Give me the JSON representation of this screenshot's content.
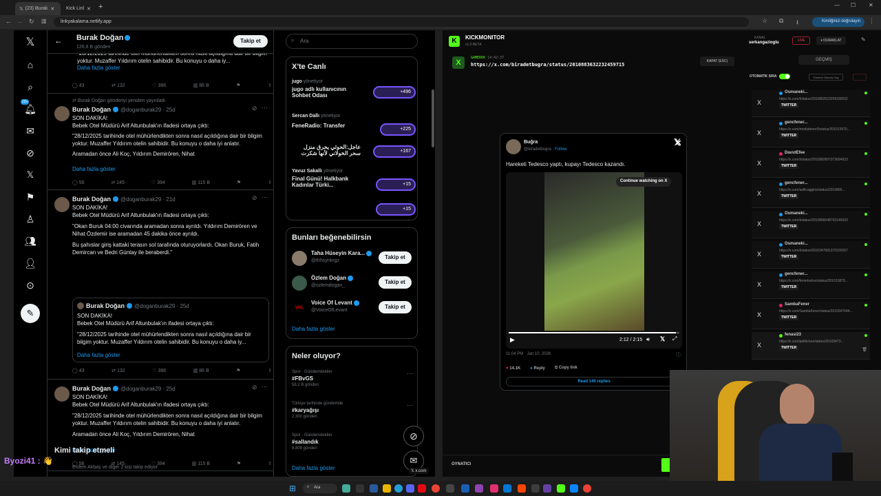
{
  "browser": {
    "tabs": [
      {
        "label": "(23) Burak"
      },
      {
        "label": "Kick Linl"
      }
    ],
    "url": "linkyakalama.netlify.app",
    "verify_label": "Kimliğinizi doğrulayın"
  },
  "profile": {
    "name": "Burak Doğan",
    "count": "126,8 B gönderi",
    "follow_label": "Takip et"
  },
  "search": {
    "placeholder": "Ara"
  },
  "nav_badge": "20+",
  "tweets": [
    {
      "text": "\"28/12/2025 tarihinde otel mühürlendikten sonra nasıl açıldığına dair bir bilgim yoktur. Muzaffer Yıldırım otelin sahibidir. Bu konuyu o daha iy...",
      "more": "Daha fazla göster",
      "replies": "43",
      "retweets": "132",
      "likes": "386",
      "views": "86 B"
    },
    {
      "repost": "Burak Doğan gönderiyi yeniden yayınladı",
      "name": "Burak Doğan",
      "handle": "@doganburak29 · 25d",
      "lines": [
        "SON DAKİKA!",
        "Bebek Otel Müdürü Arif Altunbulak'ın ifadesi ortaya çıktı:",
        "\"28/12/2025 tarihinde otel mühürlendikten sonra nasıl açıldığına dair bir bilgim yoktur. Muzaffer Yıldırım otelin sahibidir. Bu konuyu o daha iyi anlatır.",
        "Aramadan önce Ali Koç, Yıldırım Demirören, Nihat"
      ],
      "more": "Daha fazla göster",
      "replies": "56",
      "retweets": "145",
      "likes": "394",
      "views": "115 B"
    },
    {
      "name": "Burak Doğan",
      "handle": "@doganburak29 · 21d",
      "lines": [
        "SON DAKİKA!",
        "Bebek Otel Müdürü Arif Altunbulak'ın ifadesi ortaya çıktı:",
        "\"Okan Buruk 04:00 civarında aramadan sonra ayrıldı. Yıldırım Demirören ve Nihat Özdemir ise aramadan 45 dakika önce ayrıldı.",
        "Bu şahıslar giriş kattaki terasın sol tarafında oturuyorlardı. Okan Buruk, Fatih Demircan ve Bedri Güntay ile beraberdi.\""
      ],
      "quote": {
        "name": "Burak Doğan",
        "handle": "@doganburak29 · 25d",
        "lines": [
          "SON DAKİKA!",
          "Bebek Otel Müdürü Arif Altunbulak'ın ifadesi ortaya çıktı:",
          "\"28/12/2025 tarihinde otel mühürlendikten sonra nasıl açıldığına dair bir bilgim yoktur. Muzaffer Yıldırım otelin sahibidir. Bu konuyu o daha iy..."
        ],
        "more": "Daha fazla göster"
      },
      "replies": "43",
      "retweets": "132",
      "likes": "386",
      "views": "86 B"
    },
    {
      "name": "Burak Doğan",
      "handle": "@doganburak29 · 25d",
      "lines": [
        "SON DAKİKA!",
        "Bebek Otel Müdürü Arif Altunbulak'ın ifadesi ortaya çıktı:",
        "\"28/12/2025 tarihinde otel mühürlendikten sonra nasıl açıldığına dair bir bilgim yoktur. Muzaffer Yıldırım otelin sahibidir. Bu konuyu o daha iyi anlatır.",
        "Aramadan önce Ali Koç, Yıldırım Demirören, Nihat"
      ],
      "more": "Daha fazla göster",
      "replies": "56",
      "retweets": "145",
      "likes": "394",
      "views": "115 B"
    }
  ],
  "who_follow": {
    "title": "Kimi takip etmeli",
    "sub": "Erdem Akbaş ve diğer 2 kişi takip ediyor"
  },
  "chat": {
    "user": "Byozi41 :",
    "emoji": "👋"
  },
  "live": {
    "title": "X'te Canlı",
    "items": [
      {
        "host": "jugo",
        "role": "yönetiyor",
        "title": "jugo adlı kullanıcının Sohbet Odası",
        "count": "+496"
      },
      {
        "host": "Sercan Dallı",
        "role": "yönetiyor",
        "title": "FeneRadio: Transfer",
        "count": "+225"
      },
      {
        "host": "",
        "role": "",
        "title": "عاجل:الحوثي يحرق منزل سحر الخولاني لأنها شكرت",
        "count": "+167"
      },
      {
        "host": "Yavuz Sakallı",
        "role": "yönetiyor",
        "title": "Final Günü! Halkbank Kadınlar Türki...",
        "count": "+15"
      },
      {
        "host": "",
        "role": "",
        "title": "",
        "count": "+15"
      }
    ]
  },
  "suggest": {
    "title": "Bunları beğenebilirsin",
    "users": [
      {
        "name": "Taha Hüseyin Kara...",
        "handle": "@thhsynkrgz",
        "btn": "Takip et"
      },
      {
        "name": "Özlem Doğan",
        "handle": "@ozlemdogan_",
        "btn": "Takip et"
      },
      {
        "name": "Voice Of Levant",
        "handle": "@VoiceOfLevant",
        "btn": "Takip et"
      }
    ],
    "more": "Daha fazla göster"
  },
  "trends": {
    "title": "Neler oluyor?",
    "items": [
      {
        "cat": "Spor · Gündemdekiler",
        "tag": "#FBvGS",
        "count": "58,2 B gönderi"
      },
      {
        "cat": "Türkiye tarihinde gündemde",
        "tag": "#karyağışı",
        "count": "2.300 gönderi"
      },
      {
        "cat": "Spor · Gündemdekiler",
        "tag": "#sallandık",
        "count": "6.809 gönderi"
      }
    ],
    "more": "Daha fazla göster"
  },
  "kick": {
    "brand": "KICKMONITOR",
    "version": "v1.0 BETA",
    "user_label": "KANAL",
    "username": "serkangazioglu",
    "live": "LIVE",
    "stop": "DURAKLAT",
    "history": "GEÇMİŞ",
    "auto_label": "OTOMATİK SIRA",
    "mark_read": "Tümünü Okundu Say",
    "active_source": "GAMER06",
    "active_time": "14:42:37",
    "active_url": "https://x.com/biradetbugra/status/2010883632232459715",
    "close_label": "KAPAT (ESC)",
    "bottom_label": "OYNATICI",
    "queue": [
      {
        "name": "Osmaneki...",
        "url": "https://x.com/i/status/2010852623299330032",
        "tag": "TWITTER"
      },
      {
        "name": "gencfener...",
        "url": "https://x.com/mediafener0/status/201013970...",
        "tag": "TWITTER"
      },
      {
        "name": "DavutEfee",
        "url": "https://x.com/i/status/2010882897373694923",
        "tag": "TWITTER"
      },
      {
        "name": "gencfener...",
        "url": "https://x.com/aslilcaggine/status/2010866...",
        "tag": "TWITTER"
      },
      {
        "name": "Osmaneki...",
        "url": "https://x.com/i/status/2010856048793145633",
        "tag": "TWITTER"
      },
      {
        "name": "Osmaneki...",
        "url": "https://x.com/i/status/2010347681370229267",
        "tag": "TWITTER"
      },
      {
        "name": "gencfener...",
        "url": "https://x.com/fenerbahce/status/201013870...",
        "tag": "TWITTER"
      },
      {
        "name": "SambaFener",
        "url": "https://x.com/SambaFener/status/2010347644...",
        "tag": "TWITTER"
      },
      {
        "name": "fenasi23",
        "url": "https://x.com/politicture/status/20103473...",
        "tag": "TWITTER"
      }
    ]
  },
  "embed": {
    "name": "Buğra",
    "handle": "@biradetbugra",
    "follow": "Follow",
    "text": "Hareketi Tedesco yaptı, kupayı Tedesco kazandı.",
    "continue": "Continue watching on X",
    "time": "2:12 / 2:15",
    "date": "11:04 PM · Jan 10, 2026",
    "likes": "14.1K",
    "reply": "Reply",
    "copy": "Copy link",
    "read": "Read 140 replies"
  },
  "taskbar": {
    "search": "Ara"
  },
  "x_small": "x.com",
  "colors": {
    "kick_green": "#53fc18",
    "x_blue": "#1d9bf0",
    "live_red": "#e0245e"
  }
}
